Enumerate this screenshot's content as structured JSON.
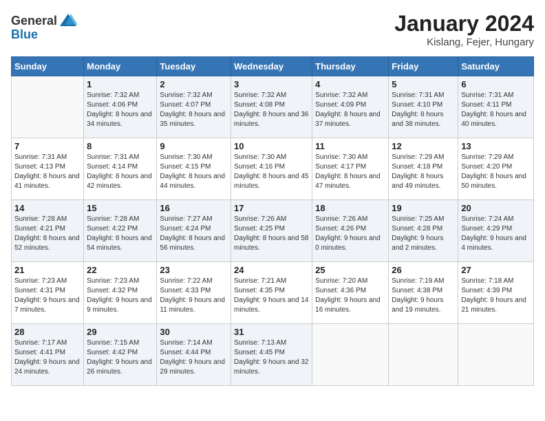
{
  "header": {
    "logo_general": "General",
    "logo_blue": "Blue",
    "month_year": "January 2024",
    "location": "Kislang, Fejer, Hungary"
  },
  "days_of_week": [
    "Sunday",
    "Monday",
    "Tuesday",
    "Wednesday",
    "Thursday",
    "Friday",
    "Saturday"
  ],
  "weeks": [
    [
      {
        "day": "",
        "sunrise": "",
        "sunset": "",
        "daylight": ""
      },
      {
        "day": "1",
        "sunrise": "Sunrise: 7:32 AM",
        "sunset": "Sunset: 4:06 PM",
        "daylight": "Daylight: 8 hours and 34 minutes."
      },
      {
        "day": "2",
        "sunrise": "Sunrise: 7:32 AM",
        "sunset": "Sunset: 4:07 PM",
        "daylight": "Daylight: 8 hours and 35 minutes."
      },
      {
        "day": "3",
        "sunrise": "Sunrise: 7:32 AM",
        "sunset": "Sunset: 4:08 PM",
        "daylight": "Daylight: 8 hours and 36 minutes."
      },
      {
        "day": "4",
        "sunrise": "Sunrise: 7:32 AM",
        "sunset": "Sunset: 4:09 PM",
        "daylight": "Daylight: 8 hours and 37 minutes."
      },
      {
        "day": "5",
        "sunrise": "Sunrise: 7:31 AM",
        "sunset": "Sunset: 4:10 PM",
        "daylight": "Daylight: 8 hours and 38 minutes."
      },
      {
        "day": "6",
        "sunrise": "Sunrise: 7:31 AM",
        "sunset": "Sunset: 4:11 PM",
        "daylight": "Daylight: 8 hours and 40 minutes."
      }
    ],
    [
      {
        "day": "7",
        "sunrise": "Sunrise: 7:31 AM",
        "sunset": "Sunset: 4:13 PM",
        "daylight": "Daylight: 8 hours and 41 minutes."
      },
      {
        "day": "8",
        "sunrise": "Sunrise: 7:31 AM",
        "sunset": "Sunset: 4:14 PM",
        "daylight": "Daylight: 8 hours and 42 minutes."
      },
      {
        "day": "9",
        "sunrise": "Sunrise: 7:30 AM",
        "sunset": "Sunset: 4:15 PM",
        "daylight": "Daylight: 8 hours and 44 minutes."
      },
      {
        "day": "10",
        "sunrise": "Sunrise: 7:30 AM",
        "sunset": "Sunset: 4:16 PM",
        "daylight": "Daylight: 8 hours and 45 minutes."
      },
      {
        "day": "11",
        "sunrise": "Sunrise: 7:30 AM",
        "sunset": "Sunset: 4:17 PM",
        "daylight": "Daylight: 8 hours and 47 minutes."
      },
      {
        "day": "12",
        "sunrise": "Sunrise: 7:29 AM",
        "sunset": "Sunset: 4:18 PM",
        "daylight": "Daylight: 8 hours and 49 minutes."
      },
      {
        "day": "13",
        "sunrise": "Sunrise: 7:29 AM",
        "sunset": "Sunset: 4:20 PM",
        "daylight": "Daylight: 8 hours and 50 minutes."
      }
    ],
    [
      {
        "day": "14",
        "sunrise": "Sunrise: 7:28 AM",
        "sunset": "Sunset: 4:21 PM",
        "daylight": "Daylight: 8 hours and 52 minutes."
      },
      {
        "day": "15",
        "sunrise": "Sunrise: 7:28 AM",
        "sunset": "Sunset: 4:22 PM",
        "daylight": "Daylight: 8 hours and 54 minutes."
      },
      {
        "day": "16",
        "sunrise": "Sunrise: 7:27 AM",
        "sunset": "Sunset: 4:24 PM",
        "daylight": "Daylight: 8 hours and 56 minutes."
      },
      {
        "day": "17",
        "sunrise": "Sunrise: 7:26 AM",
        "sunset": "Sunset: 4:25 PM",
        "daylight": "Daylight: 8 hours and 58 minutes."
      },
      {
        "day": "18",
        "sunrise": "Sunrise: 7:26 AM",
        "sunset": "Sunset: 4:26 PM",
        "daylight": "Daylight: 9 hours and 0 minutes."
      },
      {
        "day": "19",
        "sunrise": "Sunrise: 7:25 AM",
        "sunset": "Sunset: 4:28 PM",
        "daylight": "Daylight: 9 hours and 2 minutes."
      },
      {
        "day": "20",
        "sunrise": "Sunrise: 7:24 AM",
        "sunset": "Sunset: 4:29 PM",
        "daylight": "Daylight: 9 hours and 4 minutes."
      }
    ],
    [
      {
        "day": "21",
        "sunrise": "Sunrise: 7:23 AM",
        "sunset": "Sunset: 4:31 PM",
        "daylight": "Daylight: 9 hours and 7 minutes."
      },
      {
        "day": "22",
        "sunrise": "Sunrise: 7:23 AM",
        "sunset": "Sunset: 4:32 PM",
        "daylight": "Daylight: 9 hours and 9 minutes."
      },
      {
        "day": "23",
        "sunrise": "Sunrise: 7:22 AM",
        "sunset": "Sunset: 4:33 PM",
        "daylight": "Daylight: 9 hours and 11 minutes."
      },
      {
        "day": "24",
        "sunrise": "Sunrise: 7:21 AM",
        "sunset": "Sunset: 4:35 PM",
        "daylight": "Daylight: 9 hours and 14 minutes."
      },
      {
        "day": "25",
        "sunrise": "Sunrise: 7:20 AM",
        "sunset": "Sunset: 4:36 PM",
        "daylight": "Daylight: 9 hours and 16 minutes."
      },
      {
        "day": "26",
        "sunrise": "Sunrise: 7:19 AM",
        "sunset": "Sunset: 4:38 PM",
        "daylight": "Daylight: 9 hours and 19 minutes."
      },
      {
        "day": "27",
        "sunrise": "Sunrise: 7:18 AM",
        "sunset": "Sunset: 4:39 PM",
        "daylight": "Daylight: 9 hours and 21 minutes."
      }
    ],
    [
      {
        "day": "28",
        "sunrise": "Sunrise: 7:17 AM",
        "sunset": "Sunset: 4:41 PM",
        "daylight": "Daylight: 9 hours and 24 minutes."
      },
      {
        "day": "29",
        "sunrise": "Sunrise: 7:15 AM",
        "sunset": "Sunset: 4:42 PM",
        "daylight": "Daylight: 9 hours and 26 minutes."
      },
      {
        "day": "30",
        "sunrise": "Sunrise: 7:14 AM",
        "sunset": "Sunset: 4:44 PM",
        "daylight": "Daylight: 9 hours and 29 minutes."
      },
      {
        "day": "31",
        "sunrise": "Sunrise: 7:13 AM",
        "sunset": "Sunset: 4:45 PM",
        "daylight": "Daylight: 9 hours and 32 minutes."
      },
      {
        "day": "",
        "sunrise": "",
        "sunset": "",
        "daylight": ""
      },
      {
        "day": "",
        "sunrise": "",
        "sunset": "",
        "daylight": ""
      },
      {
        "day": "",
        "sunrise": "",
        "sunset": "",
        "daylight": ""
      }
    ]
  ]
}
